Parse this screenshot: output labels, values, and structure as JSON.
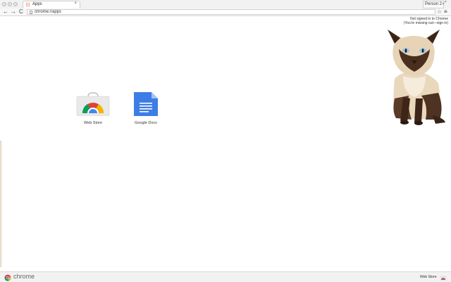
{
  "tab": {
    "title": "Apps",
    "close": "×"
  },
  "profile": {
    "name": "Person 2"
  },
  "toolbar": {
    "back": "←",
    "forward": "→",
    "reload": "C",
    "url": "chrome://apps",
    "star": "☆",
    "menu": "≡"
  },
  "signin": {
    "line1": "Not signed in to Chrome",
    "line2": "(You're missing out—sign in)"
  },
  "apps": [
    {
      "label": "Web Store"
    },
    {
      "label": "Google Docs"
    }
  ],
  "bottom": {
    "brand": "chrome",
    "webstore": "Web Store"
  },
  "colors": {
    "accent": "#4285f4",
    "red": "#db4437",
    "yellow": "#f4b400",
    "green": "#0f9d58"
  }
}
